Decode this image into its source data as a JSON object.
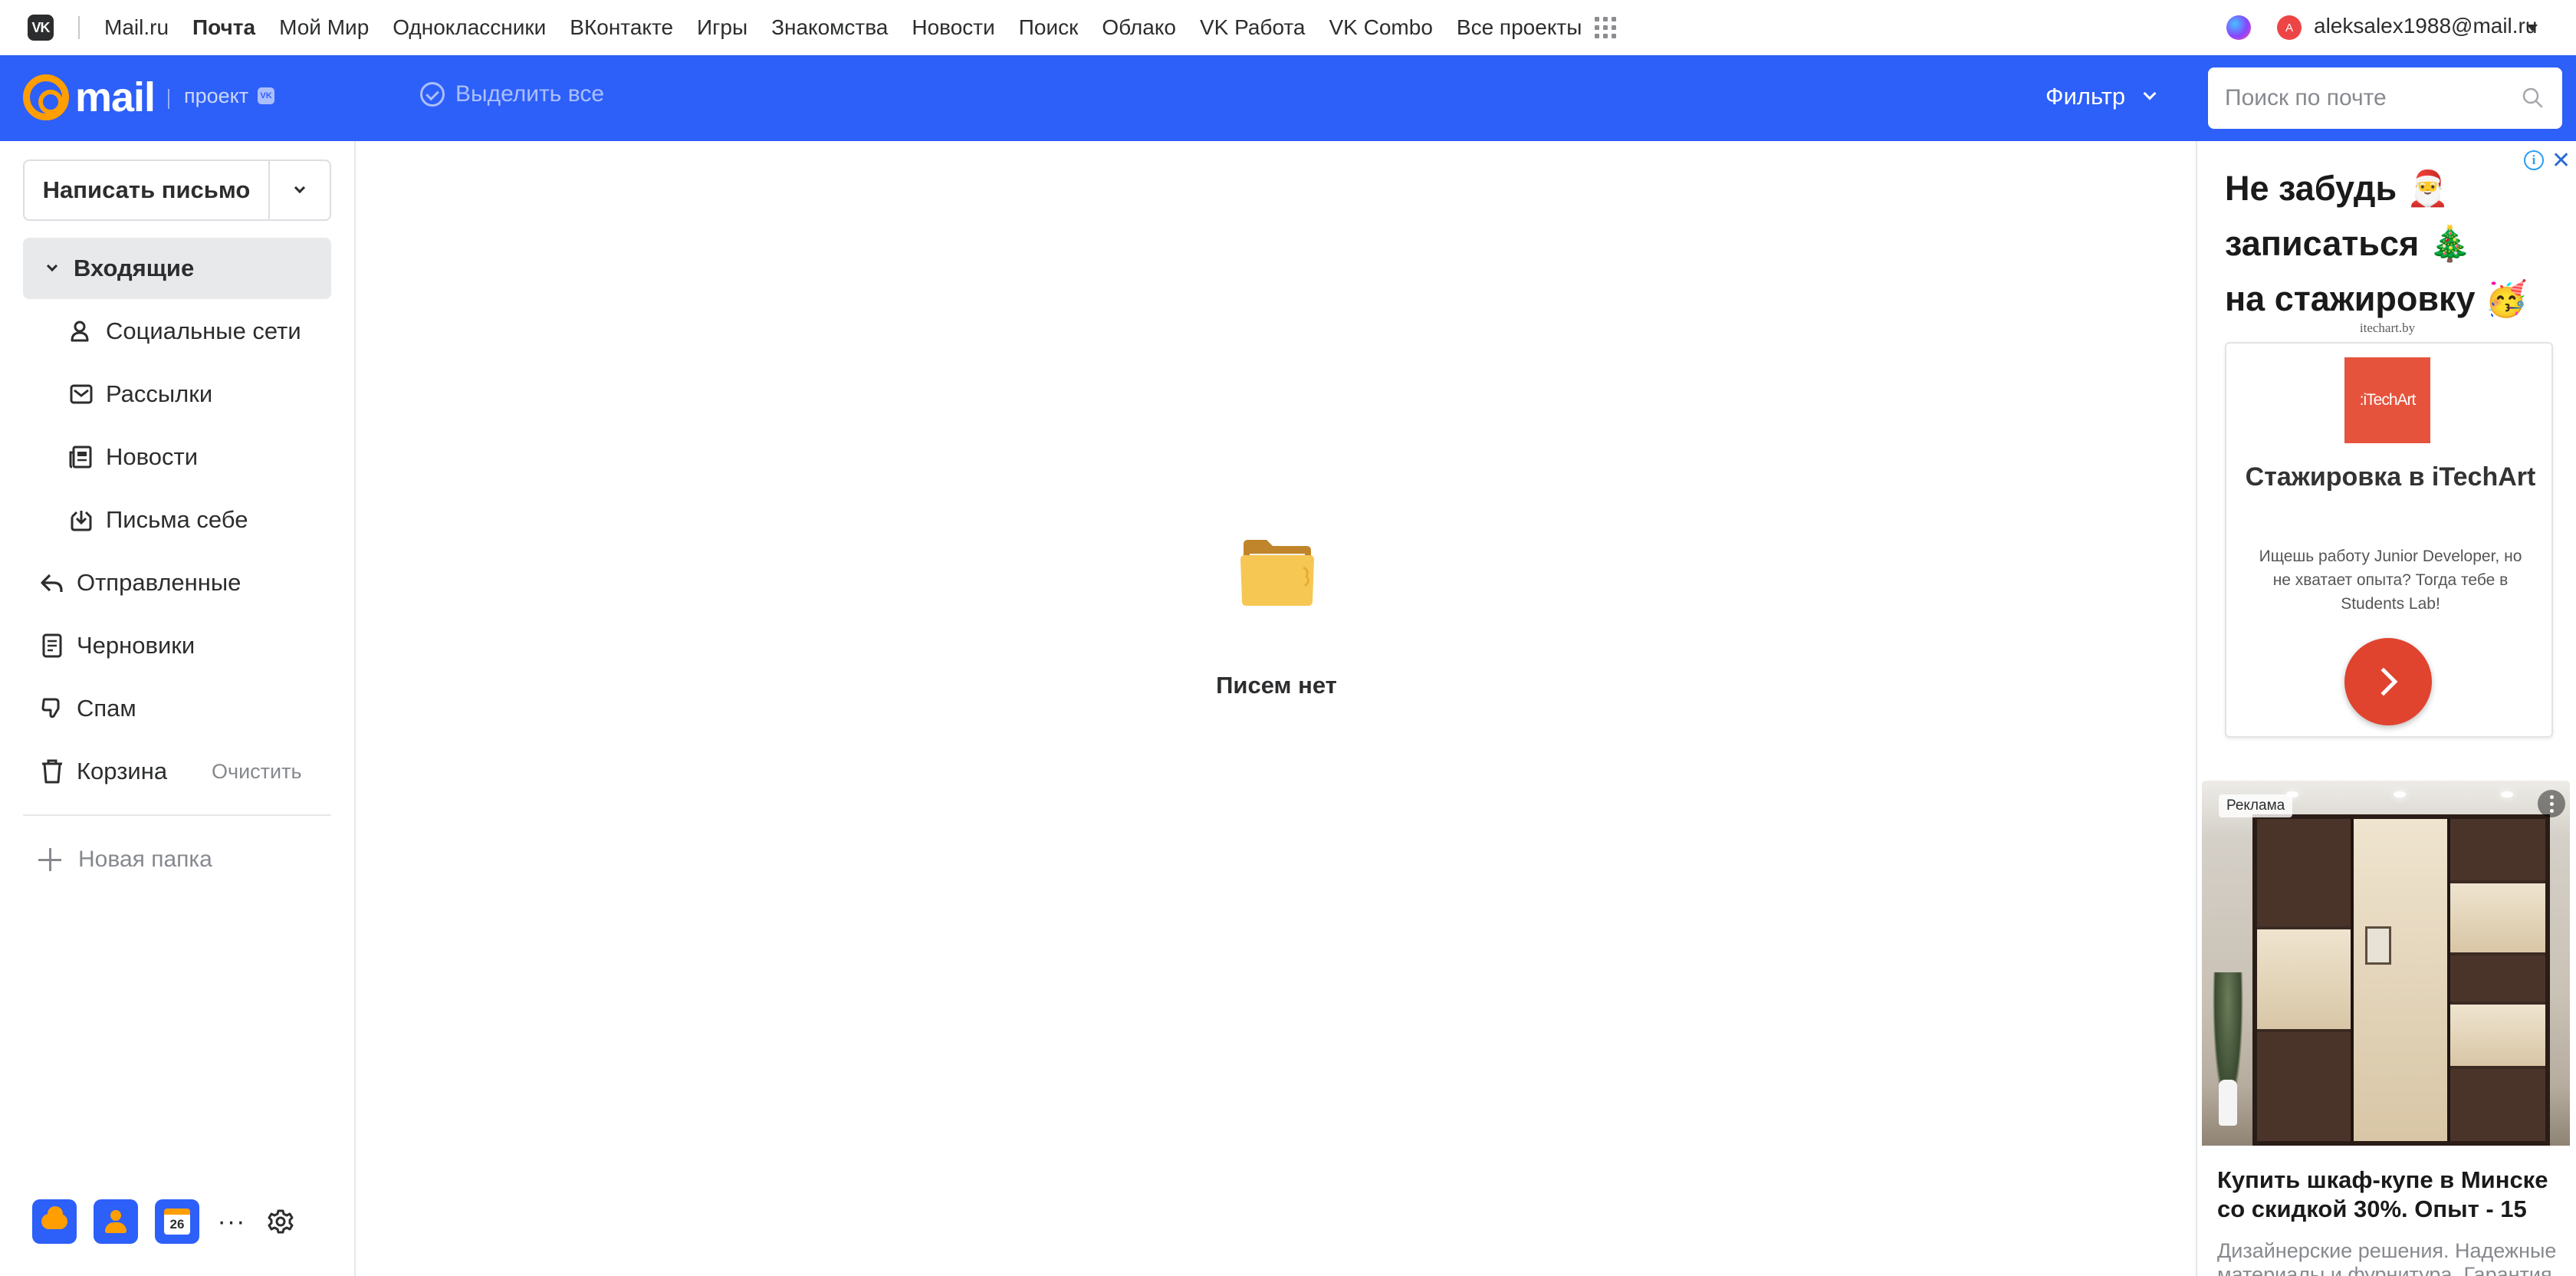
{
  "portal": {
    "logo": "VK",
    "nav": [
      {
        "label": "Mail.ru",
        "active": false
      },
      {
        "label": "Почта",
        "active": true
      },
      {
        "label": "Мой Мир",
        "active": false
      },
      {
        "label": "Одноклассники",
        "active": false
      },
      {
        "label": "ВКонтакте",
        "active": false
      },
      {
        "label": "Игры",
        "active": false
      },
      {
        "label": "Знакомства",
        "active": false
      },
      {
        "label": "Новости",
        "active": false
      },
      {
        "label": "Поиск",
        "active": false
      },
      {
        "label": "Облако",
        "active": false
      },
      {
        "label": "VK Работа",
        "active": false
      },
      {
        "label": "VK Combo",
        "active": false
      },
      {
        "label": "Все проекты",
        "active": false
      }
    ],
    "user": {
      "avatar_letter": "A",
      "email": "aleksalex1988@mail.ru"
    }
  },
  "header": {
    "logo_word": "mail",
    "project_label": "проект",
    "project_badge": "VK",
    "select_all_label": "Выделить все",
    "filter_label": "Фильтр",
    "search_placeholder": "Поиск по почте",
    "accent_color": "#2d5ff9"
  },
  "sidebar": {
    "compose_label": "Написать письмо",
    "folders": {
      "inbox": "Входящие",
      "social": "Социальные сети",
      "newsletters": "Рассылки",
      "news": "Новости",
      "to_self": "Письма себе",
      "sent": "Отправленные",
      "drafts": "Черновики",
      "spam": "Спам",
      "trash": "Корзина"
    },
    "trash_clear_label": "Очистить",
    "new_folder_label": "Новая папка",
    "calendar_day": "26",
    "more_label": "···"
  },
  "main": {
    "empty_text": "Писем нет"
  },
  "ads": {
    "ad1": {
      "info_label": "i",
      "close_label": "✕",
      "headline_line1": "Не забудь 🎅",
      "headline_line2": "записаться 🎄",
      "headline_line3": "на стажировку 🥳",
      "domain": "itechart.by",
      "logo_text": ":iTechArt",
      "title": "Стажировка в iTechArt",
      "description": "Ищешь работу Junior Developer, но не хватает опыта? Тогда тебе в Students Lab!"
    },
    "ad2": {
      "badge": "Реклама",
      "title": "Купить шкаф-купе в Минске со скидкой 30%. Опыт - 15",
      "description": "Дизайнерские решения. Надежные материалы и фурнитура. Гарантия."
    }
  }
}
